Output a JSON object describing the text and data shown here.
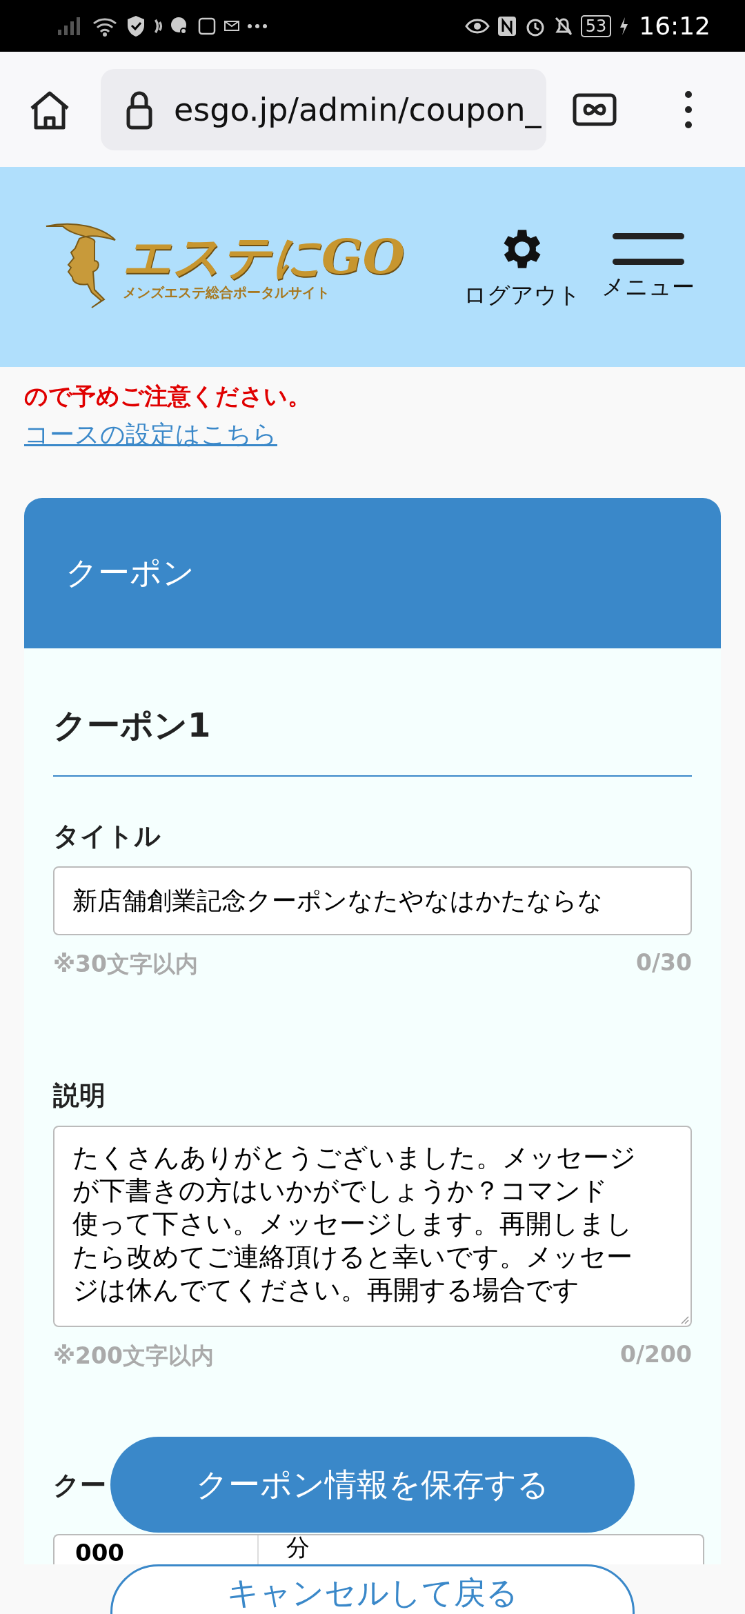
{
  "status_bar": {
    "battery": "53",
    "time": "16:12"
  },
  "browser": {
    "url": "esgo.jp/admin/coupon_"
  },
  "header": {
    "logo_title": "エステにGO",
    "logo_subtitle": "メンズエステ総合ポータルサイト",
    "logout": "ログアウト",
    "menu": "メニュー"
  },
  "notice": "ので予めご注意ください。",
  "course_link": "コースの設定はこちら",
  "card": {
    "title": "クーポン",
    "section_title": "クーポン1",
    "fields": [
      {
        "kind": "input",
        "label": "タイトル",
        "value": "新店舗創業記念クーポンなたやなはかたならな",
        "hint": "※30文字以内",
        "counter": "0/30"
      },
      {
        "kind": "textarea",
        "label": "説明",
        "lines": [
          "たくさんありがとうございました。メッセージ",
          "が下書きの方はいかがでしょうか？コマンド",
          "使って下さい。メッセージします。再開しまし",
          "たら改めてご連絡頂けると幸いです。メッセー",
          "ジは休んでてください。再開する場合です"
        ],
        "hint": "※200文字以内",
        "counter": "0/200"
      },
      {
        "kind": "minutes",
        "label": "クー",
        "value": "000",
        "unit": "分"
      }
    ]
  },
  "buttons": {
    "save": "クーポン情報を保存する",
    "cancel": "キャンセルして戻る"
  }
}
